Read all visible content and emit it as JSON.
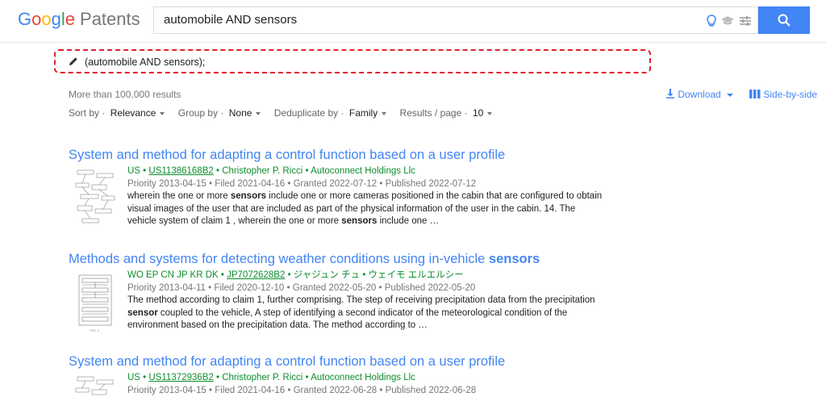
{
  "header": {
    "logo": {
      "google": "Google",
      "patents": "Patents"
    },
    "search_value": "automobile AND sensors",
    "icons": [
      "lightbulb-icon",
      "graduation-cap-icon",
      "tune-icon",
      "search-icon"
    ]
  },
  "query_bar": {
    "text": "(automobile AND sensors);"
  },
  "results_meta": {
    "count_text": "More than 100,000 results",
    "sort_label": "Sort by",
    "sort_value": "Relevance",
    "group_label": "Group by",
    "group_value": "None",
    "dedup_label": "Deduplicate by",
    "dedup_value": "Family",
    "per_page_label": "Results / page",
    "per_page_value": "10",
    "download_label": "Download",
    "side_by_side_label": "Side-by-side"
  },
  "results": [
    {
      "title": "System and method for adapting a control function based on a user profile",
      "countries": "US",
      "number": "US11386168B2",
      "inventor": "Christopher P. Ricci",
      "assignee": "Autoconnect Holdings Llc",
      "priority": "Priority 2013-04-15",
      "filed": "Filed 2021-04-16",
      "granted": "Granted 2022-07-12",
      "published": "Published 2022-07-12",
      "snippet_parts": [
        "wherein the one or more ",
        "sensors",
        " include one or more cameras positioned in the cabin that are configured to obtain visual images of the user that are included as part of the physical information of the user in the cabin. 14. The vehicle system of claim 1 , wherein the one or more ",
        "sensors",
        " include one …"
      ]
    },
    {
      "title_parts": [
        "Methods and systems for detecting weather conditions using in-vehicle ",
        "sensors"
      ],
      "countries": "WO EP CN JP KR DK",
      "number": "JP7072628B2",
      "inventor": "ジャジュン チュ",
      "assignee": "ウェイモ エルエルシー",
      "priority": "Priority 2013-04-11",
      "filed": "Filed 2020-12-10",
      "granted": "Granted 2022-05-20",
      "published": "Published 2022-05-20",
      "snippet_parts": [
        "The method according to claim 1, further comprising. The step of receiving precipitation data from the precipitation ",
        "sensor",
        " coupled to the vehicle, A step of identifying a second indicator of the meteorological condition of the environment based on the precipitation data. The method according to …"
      ]
    },
    {
      "title": "System and method for adapting a control function based on a user profile",
      "countries": "US",
      "number": "US11372936B2",
      "inventor": "Christopher P. Ricci",
      "assignee": "Autoconnect Holdings Llc",
      "priority": "Priority 2013-04-15",
      "filed": "Filed 2021-04-16",
      "granted": "Granted 2022-06-28",
      "published": "Published 2022-06-28"
    }
  ],
  "colors": {
    "link": "#4285f4",
    "meta": "#0d8e2d",
    "highlight_border": "#e0202c",
    "search_button": "#4285f4"
  }
}
